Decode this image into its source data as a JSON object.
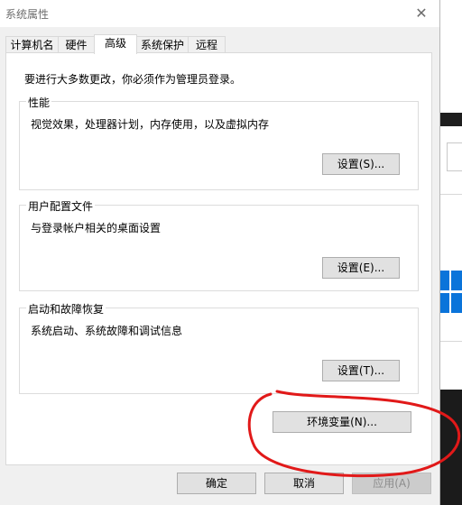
{
  "window": {
    "title": "系统属性",
    "close_glyph": "✕"
  },
  "tabs": [
    {
      "label": "计算机名"
    },
    {
      "label": "硬件"
    },
    {
      "label": "高级"
    },
    {
      "label": "系统保护"
    },
    {
      "label": "远程"
    }
  ],
  "active_tab": "高级",
  "notice": "要进行大多数更改，你必须作为管理员登录。",
  "performance": {
    "title": "性能",
    "description": "视觉效果，处理器计划，内存使用，以及虚拟内存",
    "button": "设置(S)..."
  },
  "user_profiles": {
    "title": "用户配置文件",
    "description": "与登录帐户相关的桌面设置",
    "button": "设置(E)..."
  },
  "startup_recovery": {
    "title": "启动和故障恢复",
    "description": "系统启动、系统故障和调试信息",
    "button": "设置(T)..."
  },
  "environment_button": "环境变量(N)...",
  "footer": {
    "ok": "确定",
    "cancel": "取消",
    "apply": "应用(A)"
  },
  "colors": {
    "annotation": "#e11919",
    "windows_logo": "#0a74da"
  }
}
